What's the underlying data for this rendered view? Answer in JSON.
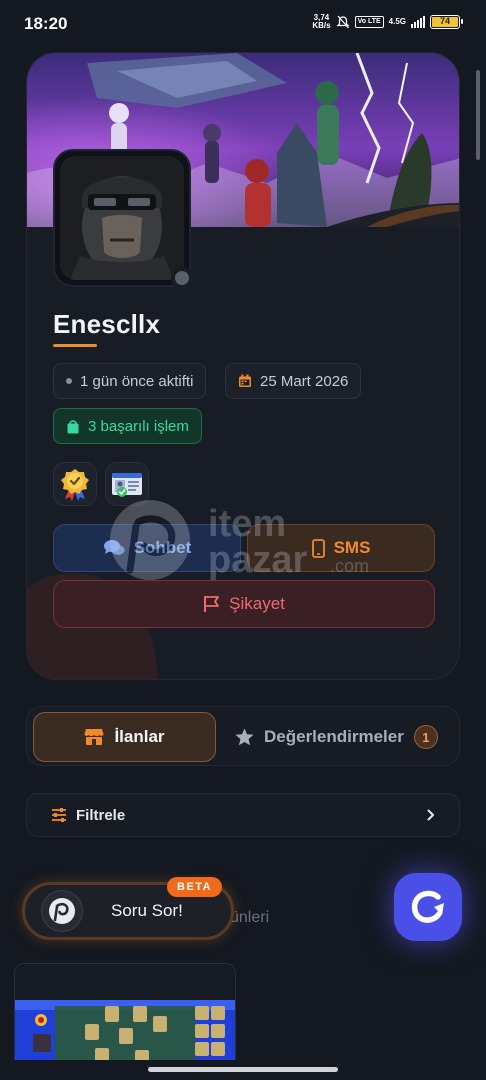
{
  "status_bar": {
    "time": "18:20",
    "speed_value": "3,74",
    "speed_unit": "KB/s",
    "volte": "Vo LTE",
    "network": "4.5G",
    "battery": "74",
    "icons": [
      "mute-icon",
      "signal-icon",
      "battery-icon"
    ]
  },
  "profile": {
    "username": "Enescllx",
    "last_active": "1 gün önce aktifti",
    "join_date": "25 Mart 2026",
    "transactions": "3 başarılı işlem",
    "badges": [
      "verified-seller-badge-icon",
      "id-verified-badge-icon"
    ],
    "online": false
  },
  "actions": {
    "chat_label": "Sohbet",
    "sms_label": "SMS",
    "report_label": "Şikayet"
  },
  "watermark": {
    "line1": "item",
    "line2": "pazar",
    "suffix": ".com"
  },
  "tabs": {
    "listings_label": "İlanlar",
    "reviews_label": "Değerlendirmeler",
    "reviews_count": "1"
  },
  "filter": {
    "label": "Filtrele"
  },
  "section": {
    "partial_title": "ünleri"
  },
  "assistant": {
    "label": "Soru Sor!",
    "beta_label": "BETA"
  },
  "colors": {
    "accent": "#f08a2a",
    "chat_blue": "#7fa7ee",
    "success_green": "#38d9a0",
    "danger_red": "#f06a70",
    "fab_purple": "#4a4fe8",
    "background": "#141820"
  }
}
